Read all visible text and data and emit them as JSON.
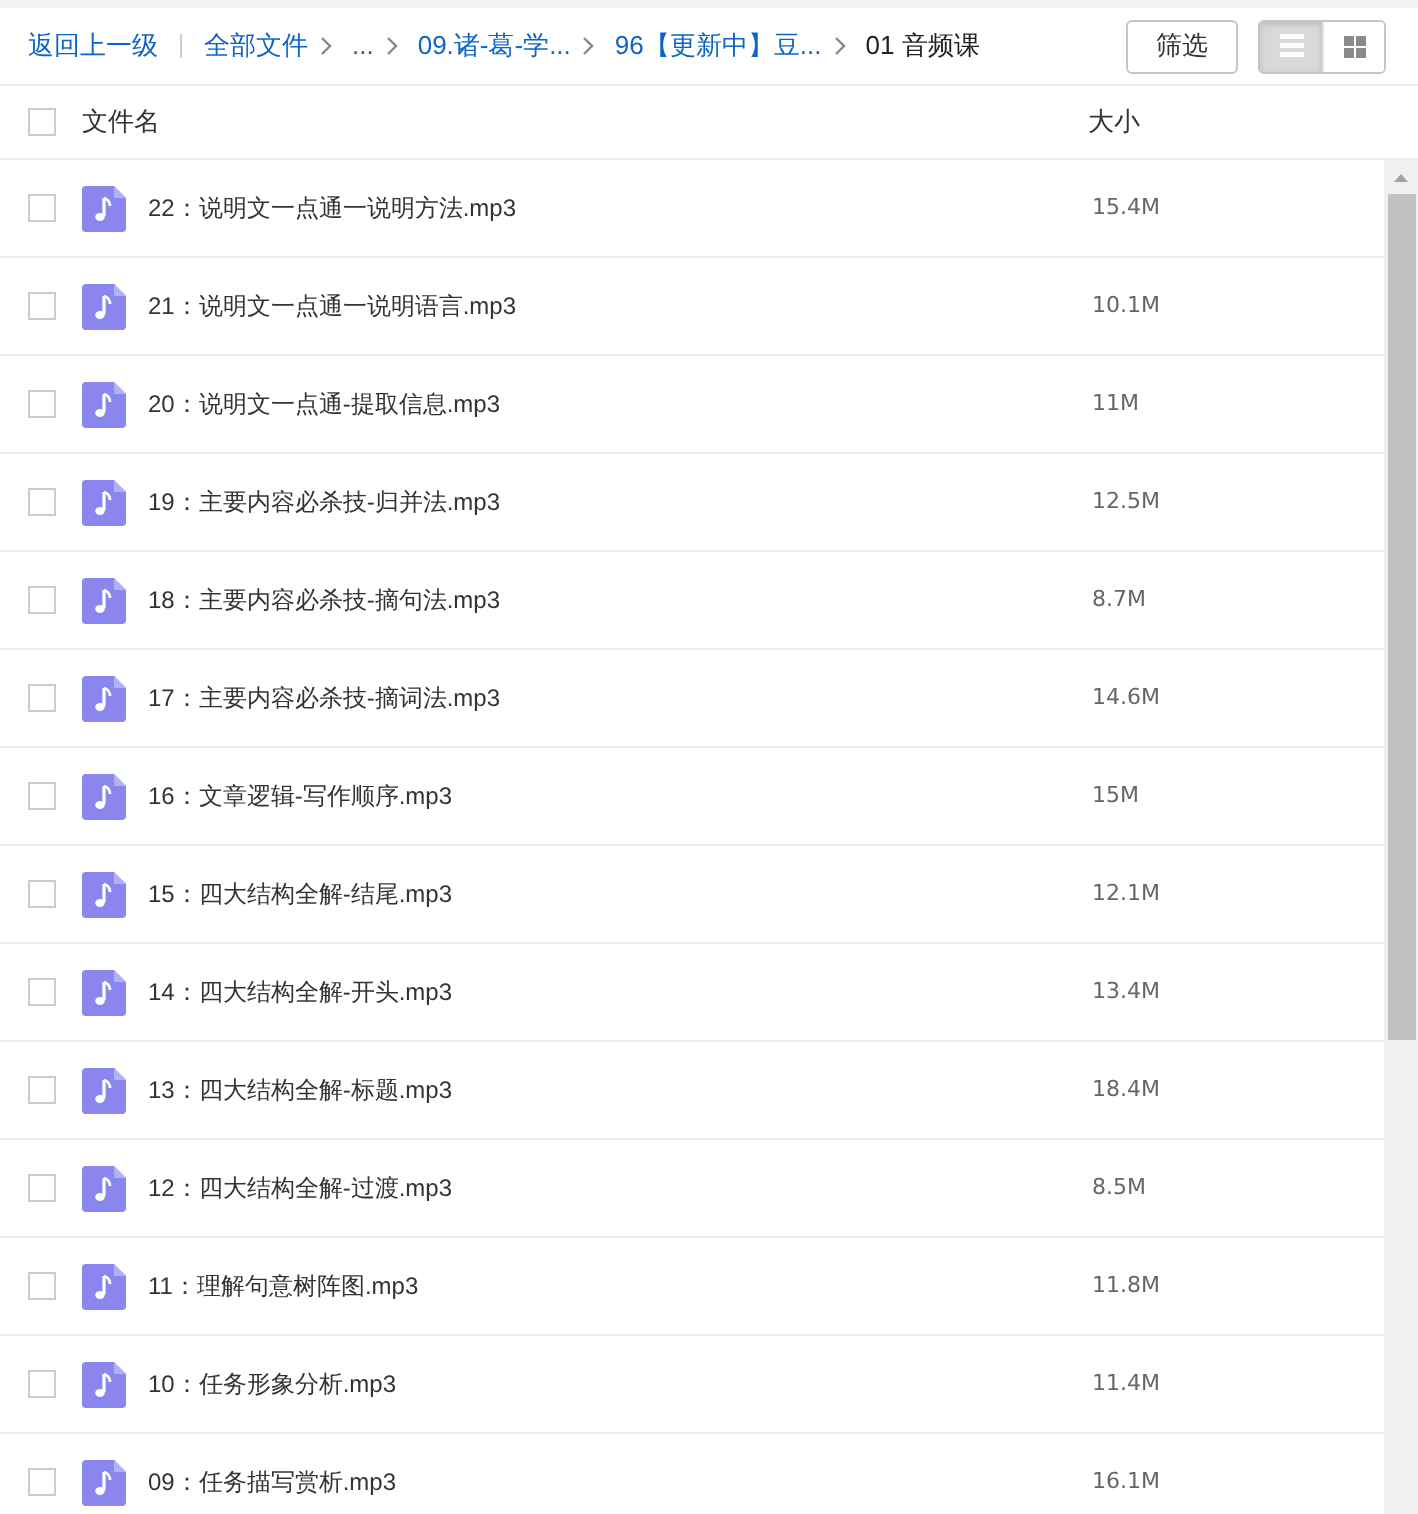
{
  "toolbar": {
    "back_link": "返回上一级",
    "breadcrumb": [
      {
        "label": "全部文件",
        "kind": "link"
      },
      {
        "label": "...",
        "kind": "ellipsis"
      },
      {
        "label": "09.诸-葛-学...",
        "kind": "link"
      },
      {
        "label": "96【更新中】豆...",
        "kind": "link"
      },
      {
        "label": "01 音频课",
        "kind": "current"
      }
    ],
    "filter_button": "筛选",
    "view_modes": [
      {
        "kind": "list",
        "selected": true
      },
      {
        "kind": "grid",
        "selected": false
      }
    ]
  },
  "table": {
    "select_all": {
      "checked": false
    },
    "columns": [
      "文件名",
      "大小"
    ],
    "rows": [
      {
        "kind": "audio",
        "name": "22：说明文一点通一说明方法.mp3",
        "size": "15.4M",
        "checked": false
      },
      {
        "kind": "audio",
        "name": "21：说明文一点通一说明语言.mp3",
        "size": "10.1M",
        "checked": false
      },
      {
        "kind": "audio",
        "name": "20：说明文一点通-提取信息.mp3",
        "size": "11M",
        "checked": false
      },
      {
        "kind": "audio",
        "name": "19：主要内容必杀技-归并法.mp3",
        "size": "12.5M",
        "checked": false
      },
      {
        "kind": "audio",
        "name": "18：主要内容必杀技-摘句法.mp3",
        "size": "8.7M",
        "checked": false
      },
      {
        "kind": "audio",
        "name": "17：主要内容必杀技-摘词法.mp3",
        "size": "14.6M",
        "checked": false
      },
      {
        "kind": "audio",
        "name": "16：文章逻辑-写作顺序.mp3",
        "size": "15M",
        "checked": false
      },
      {
        "kind": "audio",
        "name": "15：四大结构全解-结尾.mp3",
        "size": "12.1M",
        "checked": false
      },
      {
        "kind": "audio",
        "name": "14：四大结构全解-开头.mp3",
        "size": "13.4M",
        "checked": false
      },
      {
        "kind": "audio",
        "name": "13：四大结构全解-标题.mp3",
        "size": "18.4M",
        "checked": false
      },
      {
        "kind": "audio",
        "name": "12：四大结构全解-过渡.mp3",
        "size": "8.5M",
        "checked": false
      },
      {
        "kind": "audio",
        "name": "11：理解句意树阵图.mp3",
        "size": "11.8M",
        "checked": false
      },
      {
        "kind": "audio",
        "name": "10：任务形象分析.mp3",
        "size": "11.4M",
        "checked": false
      },
      {
        "kind": "audio",
        "name": "09：任务描写赏析.mp3",
        "size": "16.1M",
        "checked": false
      }
    ]
  }
}
